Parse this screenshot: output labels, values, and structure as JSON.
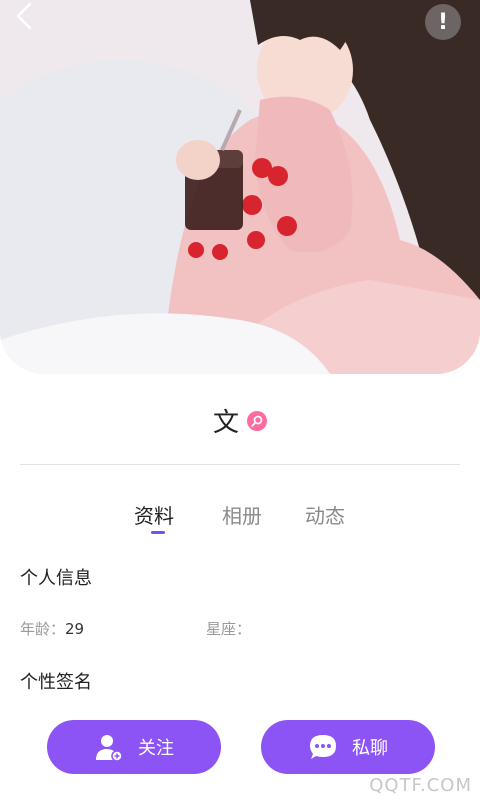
{
  "header": {
    "back_icon": "chevron-left-icon",
    "report_label": "!"
  },
  "profile": {
    "name": "文",
    "gender_icon": "female-icon"
  },
  "tabs": [
    {
      "label": "资料",
      "active": true
    },
    {
      "label": "相册",
      "active": false
    },
    {
      "label": "动态",
      "active": false
    }
  ],
  "personal_info": {
    "title": "个人信息",
    "age_label": "年龄：",
    "age_value": "29",
    "zodiac_label": "星座：",
    "zodiac_value": ""
  },
  "signature": {
    "title": "个性签名"
  },
  "actions": {
    "follow_label": "关注",
    "chat_label": "私聊"
  },
  "watermark": "QQTF.COM",
  "colors": {
    "accent": "#8d54f5",
    "tab_indicator": "#7a4ef0",
    "gender": "#ff6aa0"
  }
}
